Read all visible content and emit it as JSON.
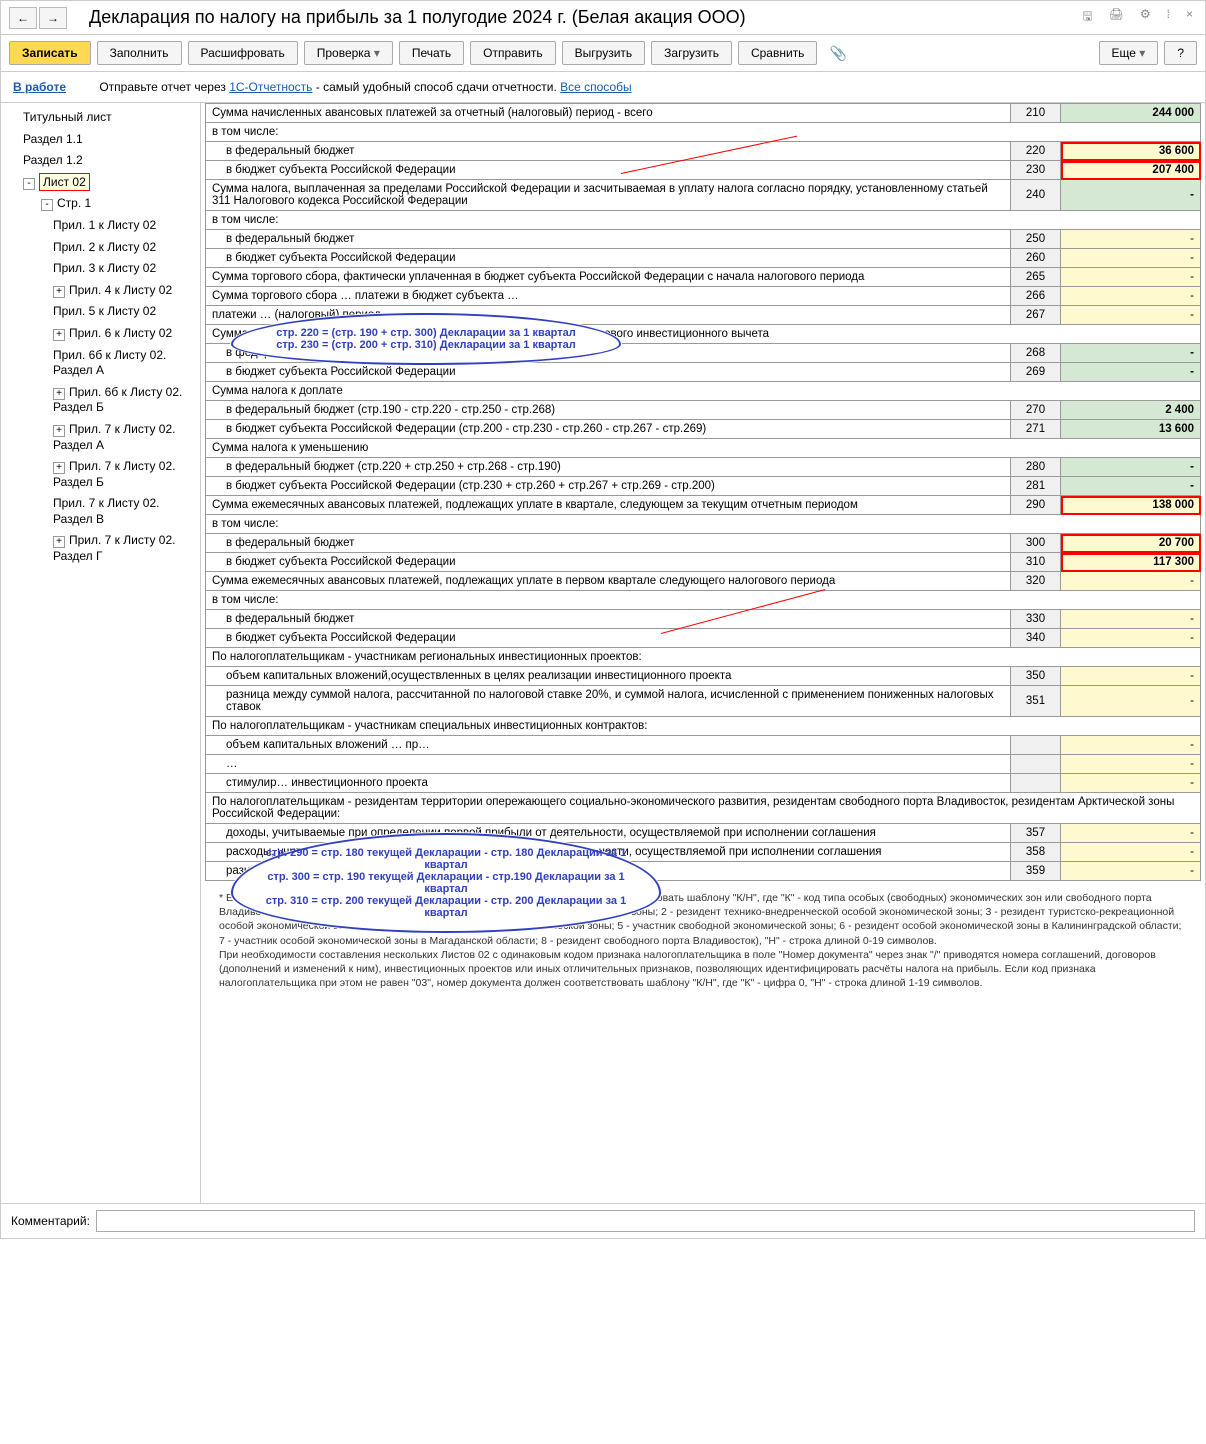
{
  "title": "Декларация по налогу на прибыль за 1 полугодие 2024 г. (Белая акация ООО)",
  "toolbar": {
    "record": "Записать",
    "fill": "Заполнить",
    "decode": "Расшифровать",
    "check": "Проверка",
    "print": "Печать",
    "send": "Отправить",
    "upload": "Выгрузить",
    "download": "Загрузить",
    "compare": "Сравнить",
    "more": "Еще",
    "help": "?"
  },
  "infobar": {
    "status": "В работе",
    "text1": "Отправьте отчет через ",
    "link1": "1С-Отчетность",
    "text2": " - самый удобный способ сдачи отчетности. ",
    "link2": "Все способы"
  },
  "tree": [
    {
      "label": "Титульный лист",
      "level": 1
    },
    {
      "label": "Раздел 1.1",
      "level": 1
    },
    {
      "label": "Раздел 1.2",
      "level": 1
    },
    {
      "label": "Лист 02",
      "level": 1,
      "toggle": "-",
      "selected": true
    },
    {
      "label": "Стр. 1",
      "level": 2,
      "toggle": "-"
    },
    {
      "label": "Прил. 1 к Листу 02",
      "level": 3
    },
    {
      "label": "Прил. 2 к Листу 02",
      "level": 3
    },
    {
      "label": "Прил. 3 к Листу 02",
      "level": 3
    },
    {
      "label": "Прил. 4 к Листу 02",
      "level": 3,
      "toggle": "+"
    },
    {
      "label": "Прил. 5 к Листу 02",
      "level": 3
    },
    {
      "label": "Прил. 6 к Листу 02",
      "level": 3,
      "toggle": "+"
    },
    {
      "label": "Прил. 6б к Листу 02. Раздел А",
      "level": 3
    },
    {
      "label": "Прил. 6б к Листу 02. Раздел Б",
      "level": 3,
      "toggle": "+"
    },
    {
      "label": "Прил. 7 к Листу 02. Раздел А",
      "level": 3,
      "toggle": "+"
    },
    {
      "label": "Прил. 7 к Листу 02. Раздел Б",
      "level": 3,
      "toggle": "+"
    },
    {
      "label": "Прил. 7 к Листу 02. Раздел В",
      "level": 3
    },
    {
      "label": "Прил. 7 к Листу 02. Раздел Г",
      "level": 3,
      "toggle": "+"
    }
  ],
  "rows": [
    {
      "desc": "Сумма начисленных авансовых платежей за отчетный (налоговый) период - всего",
      "code": "210",
      "val": "244 000",
      "cls": "val-green"
    },
    {
      "desc": "в том числе:",
      "section": true
    },
    {
      "desc": "в федеральный бюджет",
      "indent": 1,
      "code": "220",
      "val": "36 600",
      "cls": "val-yellow hl"
    },
    {
      "desc": "в бюджет субъекта Российской Федерации",
      "indent": 1,
      "code": "230",
      "val": "207 400",
      "cls": "val-yellow hl"
    },
    {
      "desc": "Сумма налога, выплаченная за пределами Российской Федерации и засчитываемая в уплату налога согласно порядку, установленному статьей 311 Налогового кодекса Российской Федерации",
      "code": "240",
      "val": "-",
      "cls": "val-green"
    },
    {
      "desc": "в том числе:",
      "section": true
    },
    {
      "desc": "в федеральный бюджет",
      "indent": 1,
      "code": "250",
      "val": "-",
      "cls": "val-yellow"
    },
    {
      "desc": "в бюджет субъекта Российской Федерации",
      "indent": 1,
      "code": "260",
      "val": "-",
      "cls": "val-yellow"
    },
    {
      "desc": "Сумма торгового сбора, фактически уплаченная в бюджет субъекта Российской Федерации с начала налогового периода",
      "code": "265",
      "val": "-",
      "cls": "val-yellow"
    },
    {
      "desc": "Сумма торгового сбора … платежи в бюджет субъекта …",
      "code": "266",
      "val": "-",
      "cls": "val-yellow"
    },
    {
      "desc": "платежи … (налоговый) период",
      "code": "267",
      "val": "-",
      "cls": "val-yellow"
    },
    {
      "desc": "Сумма уменьшения авансовых платежей (налога) при применении налогового инвестиционного вычета",
      "section": true
    },
    {
      "desc": "в федеральный бюджет",
      "indent": 1,
      "code": "268",
      "val": "-",
      "cls": "val-green"
    },
    {
      "desc": "в бюджет субъекта Российской Федерации",
      "indent": 1,
      "code": "269",
      "val": "-",
      "cls": "val-green"
    },
    {
      "desc": "Сумма налога к доплате",
      "section": true
    },
    {
      "desc": "в федеральный бюджет (стр.190 - стр.220 - стр.250 - стр.268)",
      "indent": 1,
      "code": "270",
      "val": "2 400",
      "cls": "val-green"
    },
    {
      "desc": "в бюджет субъекта Российской Федерации (стр.200 - стр.230 - стр.260 - стр.267 - стр.269)",
      "indent": 1,
      "code": "271",
      "val": "13 600",
      "cls": "val-green"
    },
    {
      "desc": "Сумма налога к уменьшению",
      "section": true
    },
    {
      "desc": "в федеральный бюджет (стр.220 + стр.250 + стр.268 - стр.190)",
      "indent": 1,
      "code": "280",
      "val": "-",
      "cls": "val-green"
    },
    {
      "desc": "в бюджет субъекта Российской Федерации (стр.230 + стр.260 + стр.267 + стр.269 - стр.200)",
      "indent": 1,
      "code": "281",
      "val": "-",
      "cls": "val-green"
    },
    {
      "desc": "Сумма ежемесячных авансовых платежей, подлежащих уплате в квартале, следующем за текущим отчетным периодом",
      "code": "290",
      "val": "138 000",
      "cls": "val-yellow hl"
    },
    {
      "desc": "в том числе:",
      "section": true
    },
    {
      "desc": "в федеральный бюджет",
      "indent": 1,
      "code": "300",
      "val": "20 700",
      "cls": "val-yellow hl"
    },
    {
      "desc": "в бюджет субъекта Российской Федерации",
      "indent": 1,
      "code": "310",
      "val": "117 300",
      "cls": "val-yellow hl"
    },
    {
      "desc": "Сумма ежемесячных авансовых платежей, подлежащих уплате в первом квартале следующего налогового периода",
      "code": "320",
      "val": "-",
      "cls": "val-yellow"
    },
    {
      "desc": "в том числе:",
      "section": true
    },
    {
      "desc": "в федеральный бюджет",
      "indent": 1,
      "code": "330",
      "val": "-",
      "cls": "val-yellow"
    },
    {
      "desc": "в бюджет субъекта Российской Федерации",
      "indent": 1,
      "code": "340",
      "val": "-",
      "cls": "val-yellow"
    },
    {
      "desc": "По налогоплательщикам - участникам региональных инвестиционных проектов:",
      "section": true
    },
    {
      "desc": "объем капитальных вложений,осуществленных в целях реализации инвестиционного проекта",
      "indent": 1,
      "code": "350",
      "val": "-",
      "cls": "val-yellow"
    },
    {
      "desc": "разница между суммой налога, рассчитанной по налоговой ставке 20%, и суммой налога, исчисленной с применением пониженных налоговых ставок",
      "indent": 1,
      "code": "351",
      "val": "-",
      "cls": "val-yellow"
    },
    {
      "desc": "По налогоплательщикам - участникам специальных инвестиционных контрактов:",
      "section": true
    },
    {
      "desc": "объем капитальных вложений … пр…",
      "indent": 1,
      "code": "",
      "val": "-",
      "cls": "val-yellow"
    },
    {
      "desc": "… ",
      "indent": 1,
      "code": "",
      "val": "-",
      "cls": "val-yellow"
    },
    {
      "desc": "стимулир… инвестиционного проекта",
      "indent": 1,
      "code": "",
      "val": "-",
      "cls": "val-yellow"
    },
    {
      "desc": "По налогоплательщикам - резидентам территории опережающего социально-экономического развития, резидентам свободного порта Владивосток, резидентам Арктической зоны Российской Федерации:",
      "section": true
    },
    {
      "desc": "доходы, учитываемые при определении первой прибыли от деятельности, осуществляемой при исполнении соглашения",
      "indent": 1,
      "code": "357",
      "val": "-",
      "cls": "val-yellow"
    },
    {
      "desc": "расходы, учитываемые при определении первой прибыли от деятельности, осуществляемой при исполнении соглашения",
      "indent": 1,
      "code": "358",
      "val": "-",
      "cls": "val-yellow"
    },
    {
      "desc": "разница между доходами и расходами, указанными по стр.357 и стр. 358",
      "indent": 1,
      "code": "359",
      "val": "-",
      "cls": "val-yellow"
    }
  ],
  "callout1": {
    "line1": "стр. 220 = (стр. 190 + стр. 300) Декларации за 1 квартал",
    "line2": "стр. 230 = (стр. 200 + стр. 310) Декларации за 1 квартал"
  },
  "callout2": {
    "line1": "стр. 290 = стр. 180 текущей Декларации - стр. 180 Декларации за 1 квартал",
    "line2": "стр. 300 = стр. 190 текущей Декларации - стр.190 Декларации за 1 квартал",
    "line3": "стр. 310 = стр. 200 текущей Декларации - стр. 200 Декларации за 1 квартал"
  },
  "footnote": "* Если код признака налогоплательщика равен \"03\", номер документа должен соответствовать шаблону \"К/Н\", где \"К\" - код типа особых (свободных) экономических зон или свободного порта Владивосток (1 - резидент промышленно-производственной особой экономической зоны; 2 - резидент технико-внедренческой особой экономической зоны; 3 - резидент туристско-рекреационной особой экономической зоны; 4 - резидент портовой особой экономической зоны; 5 - участник свободной экономической зоны; 6 - резидент особой экономической зоны в Калининградской области; 7 - участник особой экономической зоны в Магаданской области; 8 - резидент свободного порта Владивосток), \"Н\" - строка длиной 0-19 символов.\n  При необходимости составления нескольких Листов 02 с одинаковым кодом признака налогоплательщика в поле \"Номер документа\" через знак \"/\" приводятся номера соглашений, договоров (дополнений и изменений к ним), инвестиционных проектов или иных отличительных признаков, позволяющих идентифицировать расчёты налога на прибыль. Если код признака налогоплательщика при этом не равен \"03\", номер документа должен соответствовать шаблону \"К/Н\", где \"К\" - цифра 0, \"Н\" - строка длиной 1-19 символов.",
  "comment": {
    "label": "Комментарий:",
    "value": ""
  }
}
